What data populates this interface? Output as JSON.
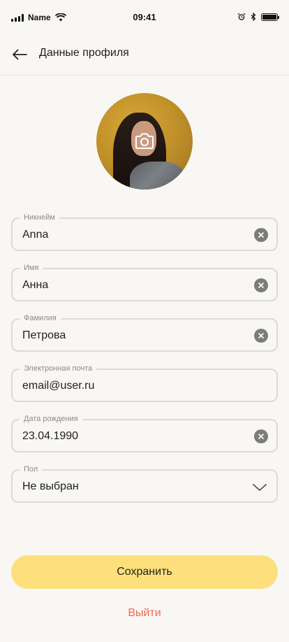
{
  "status_bar": {
    "carrier": "Name",
    "time": "09:41"
  },
  "header": {
    "title": "Данные профиля",
    "back_icon": "arrow-left-icon"
  },
  "avatar": {
    "overlay_icon": "camera-icon"
  },
  "fields": {
    "nickname": {
      "label": "Никнейм",
      "value": "Anna"
    },
    "first_name": {
      "label": "Имя",
      "value": "Анна"
    },
    "last_name": {
      "label": "Фамилия",
      "value": "Петрова"
    },
    "email": {
      "label": "Электронная почта",
      "value": "email@user.ru"
    },
    "birth_date": {
      "label": "Дата рождения",
      "value": "23.04.1990"
    },
    "gender": {
      "label": "Пол",
      "value": "Не выбран"
    }
  },
  "actions": {
    "save_label": "Сохранить",
    "logout_label": "Выйти"
  },
  "colors": {
    "background": "#f9f7f4",
    "save_button": "#fde07c",
    "logout_text": "#ee6a4f",
    "field_border": "#dcdad6"
  }
}
